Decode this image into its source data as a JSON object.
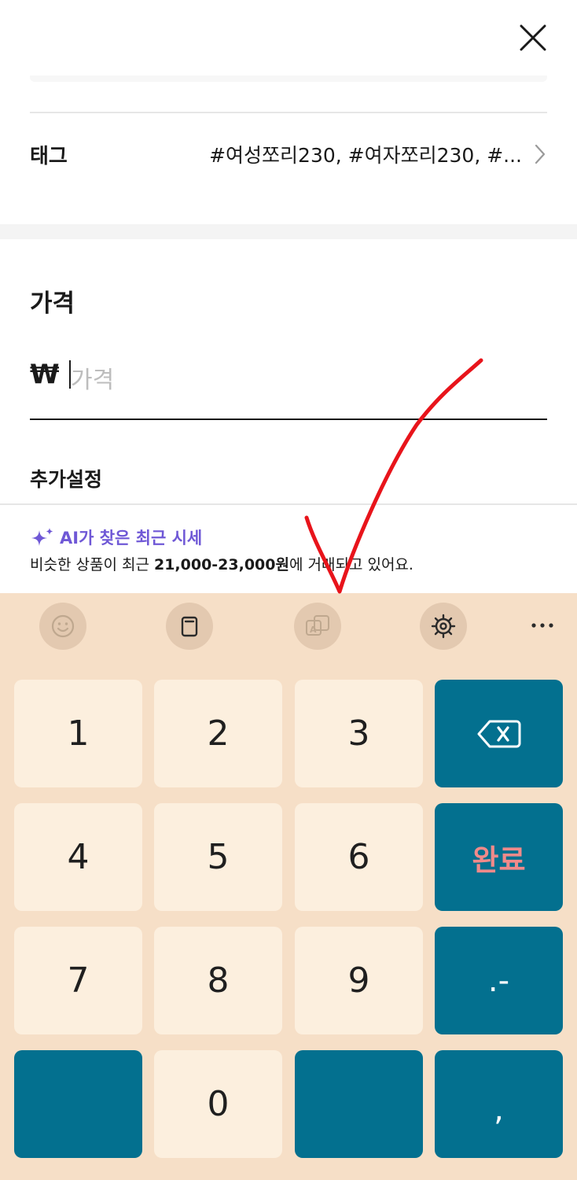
{
  "header": {
    "close_icon": "close-icon"
  },
  "tag_row": {
    "label": "태그",
    "value": "#여성쪼리230, #여자쪼리230, #...",
    "chevron_icon": "chevron-right-icon"
  },
  "price": {
    "title": "가격",
    "currency": "₩",
    "placeholder": "가격"
  },
  "extra_settings": {
    "title": "추가설정"
  },
  "ai_market": {
    "icon": "sparkle-icon",
    "title": "AI가 찾은 최근 시세",
    "desc_prefix": "비슷한 상품이 최근 ",
    "desc_range": "21,000-23,000원",
    "desc_suffix": "에 거래되고 있어요."
  },
  "keyboard": {
    "toolbar_icons": [
      "emoji-icon",
      "clipboard-icon",
      "translate-icon",
      "settings-icon",
      "more-icon"
    ],
    "keys": {
      "k1": "1",
      "k2": "2",
      "k3": "3",
      "k4": "4",
      "k5": "5",
      "k6": "6",
      "k7": "7",
      "k8": "8",
      "k9": "9",
      "k0": "0",
      "done": "완료",
      "dot_dash": ".-",
      "comma": ","
    },
    "colors": {
      "background": "#f6dfc7",
      "key_light": "#fcefde",
      "key_dark": "#03708f",
      "done_text": "#f08a8a"
    }
  },
  "annotation": {
    "checkmark_color": "#e8141b"
  }
}
